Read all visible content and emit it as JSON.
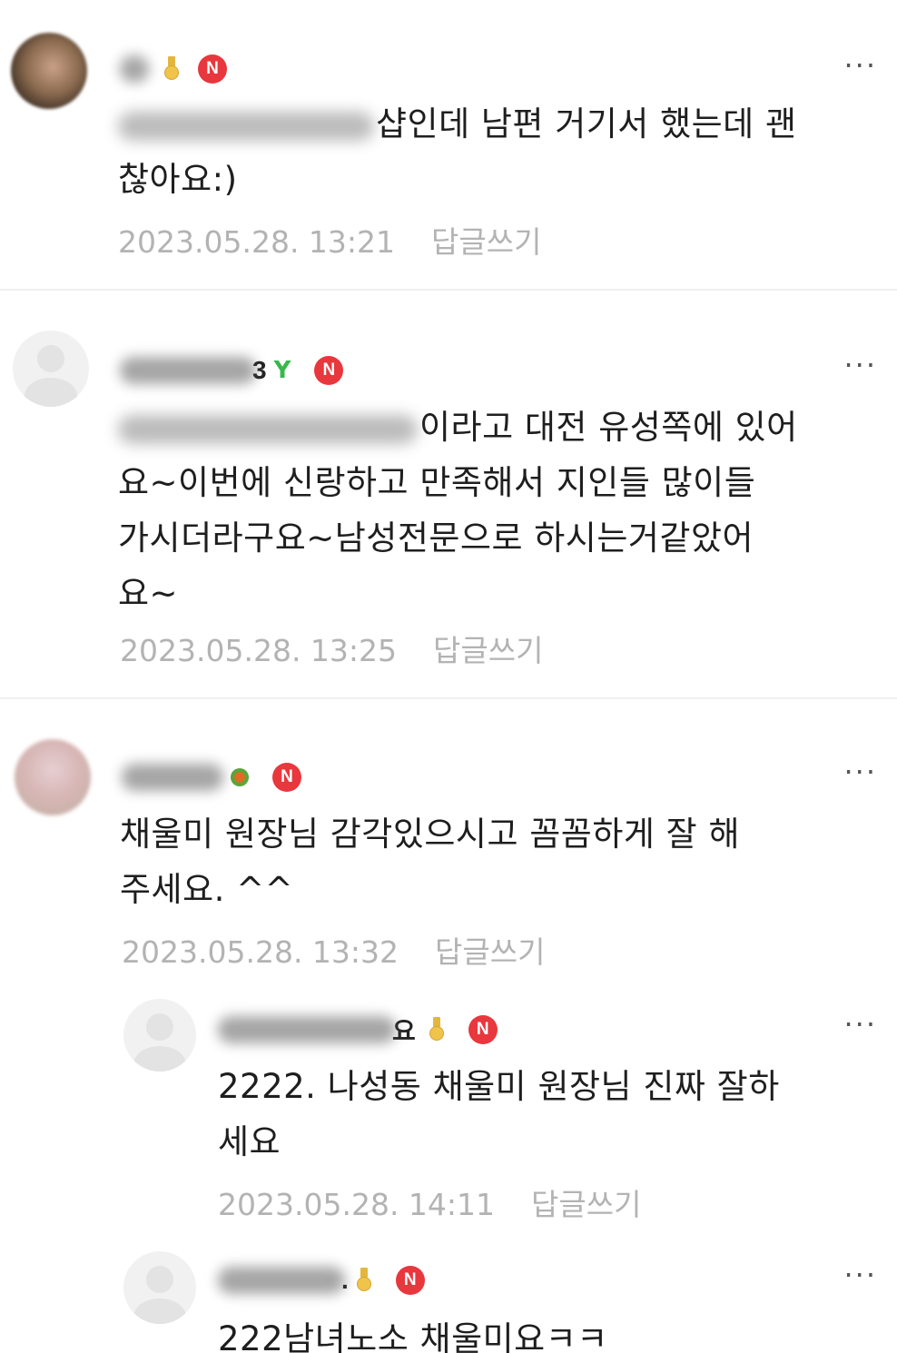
{
  "comments": [
    {
      "body_lines": [
        "샵인데 남편 거기서 했는데 괜",
        "찮아요:)"
      ],
      "date": "2023.05.28. 13:21",
      "reply_label": "답글쓰기",
      "badge": "N",
      "more": "···"
    },
    {
      "nick_tail": "3",
      "body_lines": [
        "이라고 대전 유성쪽에 있어",
        "요~이번에 신랑하고 만족해서 지인들 많이들",
        "가시더라구요~남성전문으로 하시는거같았어",
        "요~"
      ],
      "date": "2023.05.28. 13:25",
      "reply_label": "답글쓰기",
      "badge": "N",
      "more": "···"
    },
    {
      "body_lines": [
        "채울미 원장님 감각있으시고 꼼꼼하게 잘 해",
        "주세요. ^^"
      ],
      "date": "2023.05.28. 13:32",
      "reply_label": "답글쓰기",
      "badge": "N",
      "more": "···"
    },
    {
      "nick_tail": "요",
      "body_lines": [
        "2222. 나성동 채울미 원장님 진짜 잘하",
        "세요"
      ],
      "date": "2023.05.28. 14:11",
      "reply_label": "답글쓰기",
      "badge": "N",
      "more": "···"
    },
    {
      "nick_tail": ".",
      "body_lines": [
        "222남녀노소 채울미요ㅋㅋ"
      ],
      "badge": "N",
      "more": "···"
    }
  ]
}
